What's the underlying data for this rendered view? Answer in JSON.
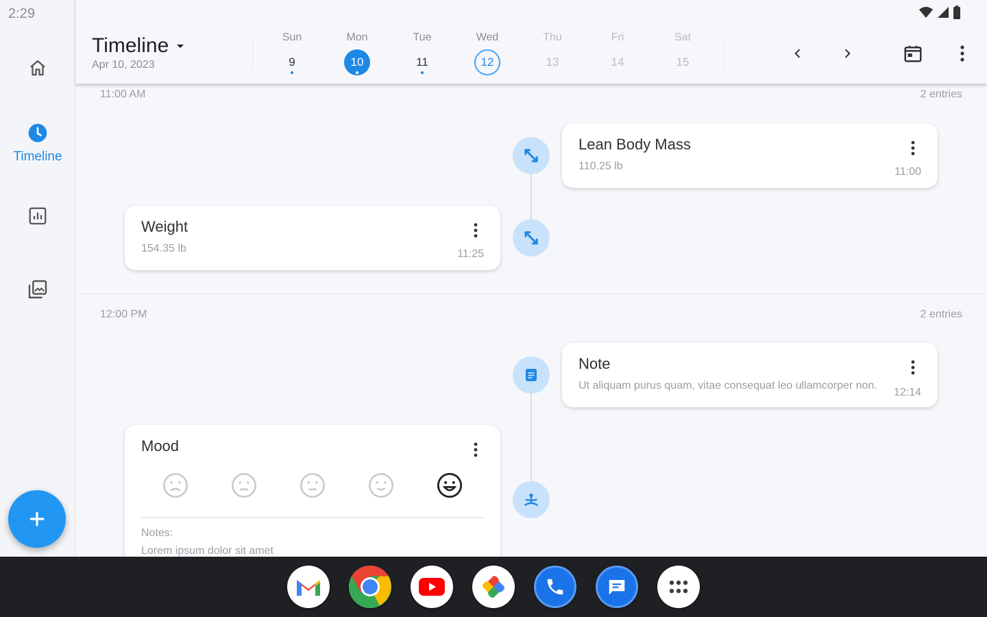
{
  "status_bar": {
    "time": "2:29"
  },
  "rail": {
    "items": [
      {
        "name": "home",
        "label": ""
      },
      {
        "name": "timeline",
        "label": "Timeline",
        "active": true
      },
      {
        "name": "stats",
        "label": ""
      },
      {
        "name": "gallery",
        "label": ""
      }
    ],
    "fab_icon": "plus-icon"
  },
  "header": {
    "title": "Timeline",
    "subtitle": "Apr 10, 2023",
    "days": [
      {
        "name": "Sun",
        "num": "9"
      },
      {
        "name": "Mon",
        "num": "10"
      },
      {
        "name": "Tue",
        "num": "11"
      },
      {
        "name": "Wed",
        "num": "12"
      },
      {
        "name": "Thu",
        "num": "13"
      },
      {
        "name": "Fri",
        "num": "14"
      },
      {
        "name": "Sat",
        "num": "15"
      }
    ]
  },
  "sections": [
    {
      "time": "11:00 AM",
      "count": "2 entries",
      "entries": [
        {
          "title": "Lean Body Mass",
          "value": "110.25 lb",
          "time": "11:00",
          "icon": "arrows-diagonal-icon"
        },
        {
          "title": "Weight",
          "value": "154.35 lb",
          "time": "11:25",
          "icon": "arrows-diagonal-icon"
        }
      ]
    },
    {
      "time": "12:00 PM",
      "count": "2 entries",
      "entries": [
        {
          "title": "Note",
          "value": "Ut aliquam purus quam, vitae consequat leo ullamcorper non.",
          "time": "12:14",
          "icon": "note-icon"
        },
        {
          "title": "Mood",
          "notes_label": "Notes:",
          "notes_text": "Lorem ipsum dolor sit amet",
          "icon": "meditation-icon",
          "selected_mood": 5
        }
      ]
    }
  ],
  "taskbar": {
    "apps": [
      "gmail-icon",
      "chrome-icon",
      "youtube-icon",
      "photos-icon",
      "phone-icon",
      "messages-icon",
      "app-drawer-icon"
    ]
  },
  "colors": {
    "accent": "#1e88e5",
    "node_bg": "#c9e2fb",
    "background": "#f6f7fa"
  }
}
